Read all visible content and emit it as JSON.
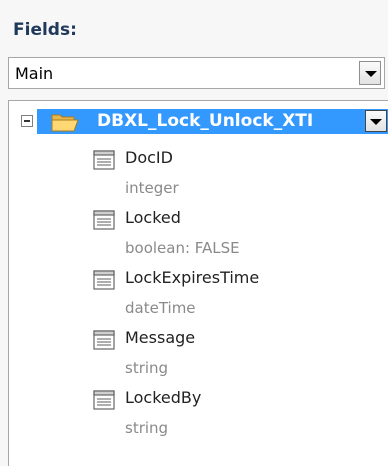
{
  "fields_label": "Fields:",
  "data_source_dropdown": {
    "selected": "Main"
  },
  "tree": {
    "root": {
      "label": "DBXL_Lock_Unlock_XTI"
    },
    "fields": [
      {
        "name": "DocID",
        "type": "integer"
      },
      {
        "name": "Locked",
        "type": "boolean: FALSE"
      },
      {
        "name": "LockExpiresTime",
        "type": "dateTime"
      },
      {
        "name": "Message",
        "type": "string"
      },
      {
        "name": "LockedBy",
        "type": "string"
      }
    ]
  },
  "icons": {
    "folder": "open-folder-icon",
    "field": "field-node-icon",
    "expander": "collapse-icon",
    "dropdown": "chevron-down-icon"
  },
  "colors": {
    "selection": "#3399ff",
    "title": "#1e395b",
    "type_text": "#8a8a8a"
  }
}
